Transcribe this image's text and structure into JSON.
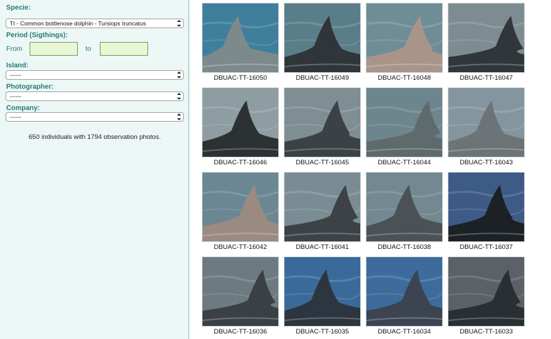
{
  "filters": {
    "specie_label": "Specie:",
    "specie_value": "Tt - Common bottlenose dolphin - Tursiops truncatus",
    "period_label": "Period (Sigthings):",
    "from_label": "From",
    "from_value": "",
    "to_label": "to",
    "to_value": "",
    "island_label": "Island:",
    "island_value": "------",
    "photographer_label": "Photographer:",
    "photographer_value": "------",
    "company_label": "Company:",
    "company_value": "------"
  },
  "summary": "650 individuals with 1794 observation photos.",
  "gallery": [
    {
      "id": "DBUAC-TT-16050",
      "sea": "#3f7f9c",
      "body": "#7d8a8c"
    },
    {
      "id": "DBUAC-TT-16049",
      "sea": "#5a7d8a",
      "body": "#2f3538"
    },
    {
      "id": "DBUAC-TT-16048",
      "sea": "#6f8d96",
      "body": "#a9948a"
    },
    {
      "id": "DBUAC-TT-16047",
      "sea": "#7d8c90",
      "body": "#30373a"
    },
    {
      "id": "DBUAC-TT-16046",
      "sea": "#8e9da1",
      "body": "#2c3134"
    },
    {
      "id": "DBUAC-TT-16045",
      "sea": "#7e8e93",
      "body": "#3b4245"
    },
    {
      "id": "DBUAC-TT-16044",
      "sea": "#6d858c",
      "body": "#5f6a6d"
    },
    {
      "id": "DBUAC-TT-16043",
      "sea": "#8595a0",
      "body": "#6c7477"
    },
    {
      "id": "DBUAC-TT-16042",
      "sea": "#6a8793",
      "body": "#9a8a80"
    },
    {
      "id": "DBUAC-TT-16041",
      "sea": "#7a8c93",
      "body": "#3c4245"
    },
    {
      "id": "DBUAC-TT-16038",
      "sea": "#738890",
      "body": "#4a5255"
    },
    {
      "id": "DBUAC-TT-16037",
      "sea": "#3e5a86",
      "body": "#1c2126"
    },
    {
      "id": "DBUAC-TT-16036",
      "sea": "#6d7a80",
      "body": "#3a4043"
    },
    {
      "id": "DBUAC-TT-16035",
      "sea": "#3a6a99",
      "body": "#2d3540"
    },
    {
      "id": "DBUAC-TT-16034",
      "sea": "#3d6c9c",
      "body": "#3b4450"
    },
    {
      "id": "DBUAC-TT-16033",
      "sea": "#5b6166",
      "body": "#2a2f33"
    }
  ]
}
